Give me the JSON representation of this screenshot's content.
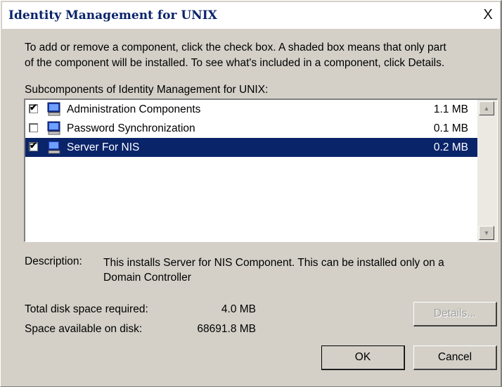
{
  "window": {
    "title": "Identity Management for UNIX",
    "close_glyph": "X"
  },
  "intro": {
    "line1": "To add or remove a component, click the check box. A shaded box means that only part",
    "line2": "of the component will be installed. To see what's included in a component, click Details."
  },
  "list": {
    "label": "Subcomponents of Identity Management for UNIX:",
    "items": [
      {
        "label": "Administration Components",
        "size": "1.1 MB",
        "checked": true,
        "selected": false,
        "icon": "computer-icon"
      },
      {
        "label": "Password Synchronization",
        "size": "0.1 MB",
        "checked": false,
        "selected": false,
        "icon": "computer-icon"
      },
      {
        "label": "Server For NIS",
        "size": "0.2 MB",
        "checked": true,
        "selected": true,
        "icon": "computer-icon"
      }
    ]
  },
  "description": {
    "label": "Description:",
    "line1": "This installs Server for NIS Component. This can be installed only on a",
    "line2": "Domain Controller"
  },
  "disk": {
    "required_label": "Total disk space required:",
    "required_value": "4.0 MB",
    "available_label": "Space available on disk:",
    "available_value": "68691.8 MB"
  },
  "buttons": {
    "details": "Details...",
    "ok": "OK",
    "cancel": "Cancel"
  },
  "colors": {
    "face": "#d4d0c8",
    "selection": "#0a246a",
    "title_text": "#0a246a"
  }
}
